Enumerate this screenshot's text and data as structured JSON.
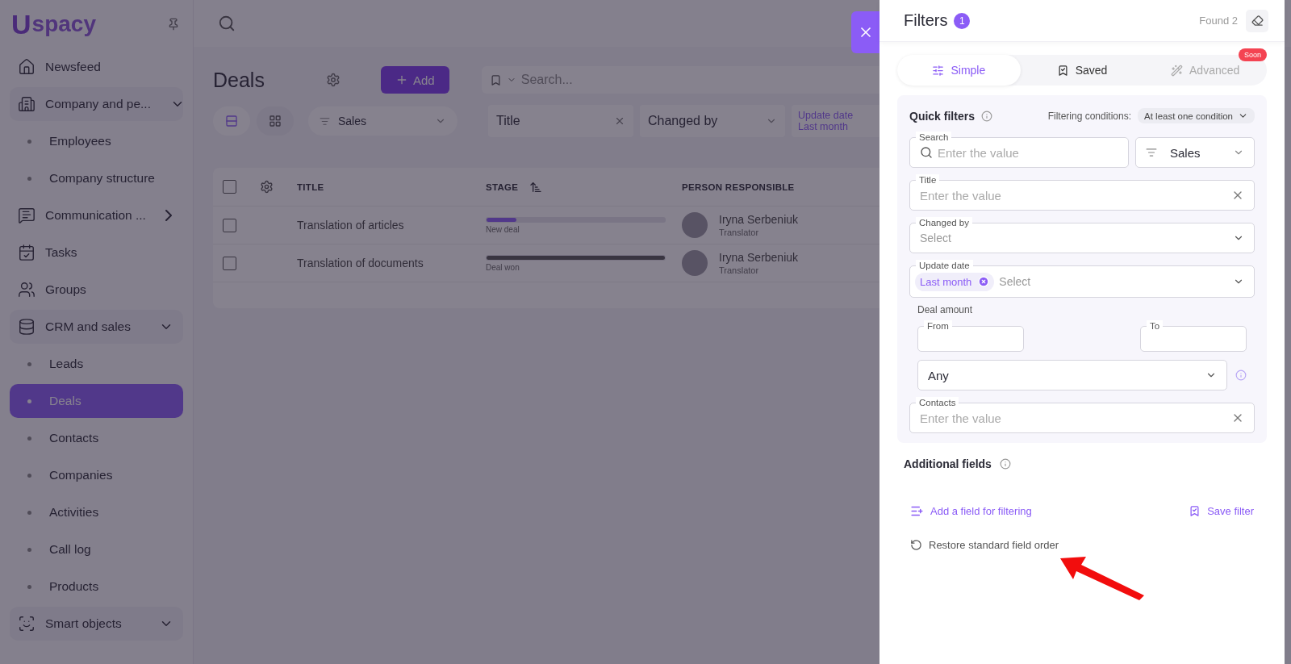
{
  "sidebar": {
    "logo": {
      "mark": "U",
      "text": "spacy"
    },
    "items": [
      {
        "label": "Newsfeed",
        "selected": false
      },
      {
        "label": "Company and pe...",
        "selected": false,
        "expanded": true,
        "children": [
          {
            "label": "Employees",
            "selected": false
          },
          {
            "label": "Company structure",
            "selected": false
          }
        ]
      },
      {
        "label": "Communication ...",
        "selected": false,
        "expanded": false
      },
      {
        "label": "Tasks",
        "selected": false
      },
      {
        "label": "Groups",
        "selected": false
      },
      {
        "label": "CRM and sales",
        "selected": false,
        "expanded": true,
        "children": [
          {
            "label": "Leads",
            "selected": false
          },
          {
            "label": "Deals",
            "selected": true
          },
          {
            "label": "Contacts",
            "selected": false
          },
          {
            "label": "Companies",
            "selected": false
          },
          {
            "label": "Activities",
            "selected": false
          },
          {
            "label": "Call log",
            "selected": false
          },
          {
            "label": "Products",
            "selected": false
          }
        ]
      },
      {
        "label": "Smart objects",
        "selected": false,
        "expanded": true
      }
    ]
  },
  "main": {
    "title": "Deals",
    "add_button": "Add",
    "search": {
      "placeholder": "Search..."
    },
    "views": [
      {
        "kind": "list",
        "selected": true
      },
      {
        "kind": "grid",
        "selected": false
      }
    ],
    "pipeline": "Sales",
    "filter_chips": [
      {
        "kind": "clearable",
        "label": "Title"
      },
      {
        "kind": "dropdown",
        "label": "Changed by"
      },
      {
        "kind": "stacked",
        "label": "Update date",
        "value": "Last month"
      }
    ],
    "table": {
      "all_checked": false,
      "columns": [
        {
          "label": "TITLE",
          "sortable": false
        },
        {
          "label": "STAGE",
          "sortable": true
        },
        {
          "label": "PERSON RESPONSIBLE",
          "sortable": false
        }
      ],
      "rows": [
        {
          "checked": false,
          "title": "Translation of articles",
          "level": 0.1667,
          "kind": "open",
          "stage": "New deal",
          "person": "Iryna Serbeniuk",
          "role": "Translator"
        },
        {
          "checked": false,
          "title": "Translation of documents",
          "level": 1,
          "kind": "won",
          "stage": "Deal won",
          "person": "Iryna Serbeniuk",
          "role": "Translator"
        }
      ]
    }
  },
  "filters": {
    "title": "Filters",
    "count": "1",
    "found": "Found 2",
    "tabs": [
      {
        "label": "Simple",
        "selected": true,
        "disabled": false
      },
      {
        "label": "Saved",
        "selected": false,
        "disabled": false
      },
      {
        "label": "Advanced",
        "selected": false,
        "disabled": true,
        "badge": "Soon"
      }
    ],
    "quick": {
      "title": "Quick filters",
      "conditions_label": "Filtering conditions:",
      "conditions_value": "At least one condition",
      "fields": [
        {
          "kind": "search",
          "label": "Search",
          "placeholder": "Enter the value",
          "pipeline": "Sales"
        },
        {
          "kind": "text",
          "label": "Title",
          "placeholder": "Enter the value"
        },
        {
          "kind": "select",
          "label": "Changed by",
          "placeholder": "Select"
        },
        {
          "kind": "chips",
          "label": "Update date",
          "chip": "Last month",
          "placeholder": "Select"
        },
        {
          "kind": "range",
          "label": "Deal amount",
          "from": "From",
          "to": "To",
          "condition": "Any"
        },
        {
          "kind": "text",
          "label": "Contacts",
          "placeholder": "Enter the value"
        }
      ]
    },
    "additional_title": "Additional fields",
    "add_field": "Add a field for filtering",
    "save_filter": "Save filter",
    "restore": "Restore standard field order"
  }
}
